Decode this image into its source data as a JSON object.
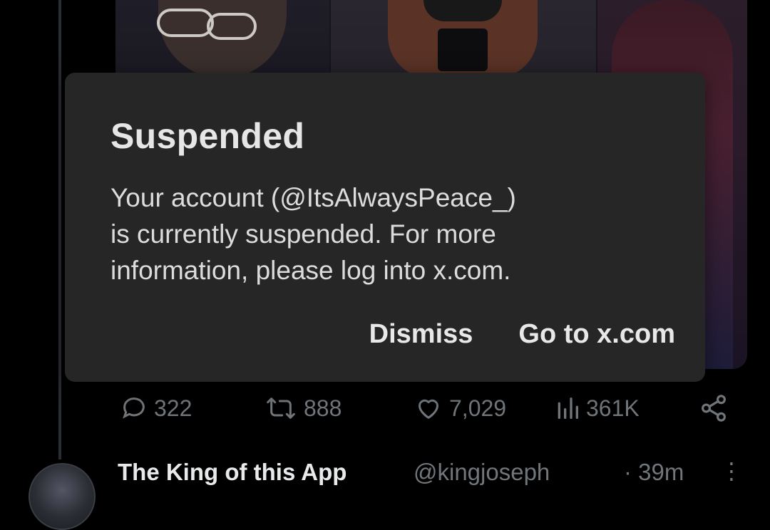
{
  "dialog": {
    "title": "Suspended",
    "body_line1": "Your account (@ItsAlwaysPeace_)",
    "body_line2": "is currently suspended. For more",
    "body_line3": "information, please log into x.com.",
    "dismiss_label": "Dismiss",
    "goto_label": "Go to x.com"
  },
  "tweet_actions": {
    "replies": "322",
    "reposts": "888",
    "likes": "7,029",
    "views": "361K"
  },
  "next_tweet": {
    "author_name": "The King of this App",
    "author_handle": "@kingjoseph",
    "time": "· 39m",
    "more": "⋮"
  },
  "icons": {
    "reply": "reply-icon",
    "repost": "repost-icon",
    "like": "heart-icon",
    "views": "views-icon",
    "share": "share-icon"
  },
  "colors": {
    "background": "#000000",
    "dialog": "#262626",
    "muted": "#71767b",
    "text": "#e7e9ea"
  }
}
